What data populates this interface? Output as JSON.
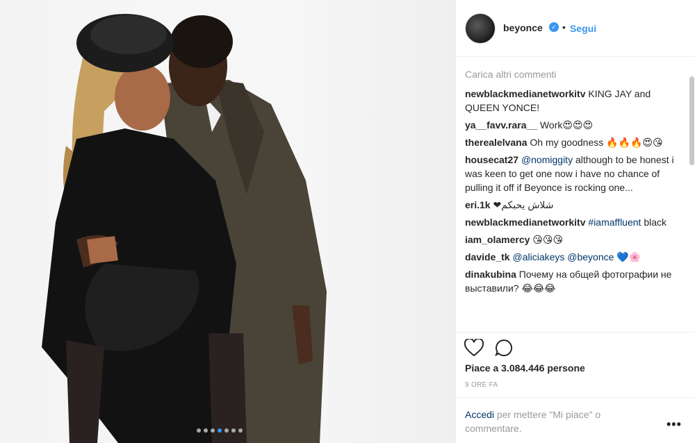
{
  "header": {
    "username": "beyonce",
    "separator": "•",
    "follow_label": "Segui"
  },
  "comments": {
    "load_more": "Carica altri commenti",
    "items": [
      {
        "user": "newblackmedianetworkitv",
        "mention": "",
        "text": "KING JAY and QUEEN YONCE!"
      },
      {
        "user": "ya__favv.rara__",
        "mention": "",
        "text": "Work😍😍😍"
      },
      {
        "user": "therealelvana",
        "mention": "",
        "text": "Oh my goodness 🔥🔥🔥😍😘"
      },
      {
        "user": "housecat27",
        "mention": "@nomiggity",
        "text": "although to be honest i was keen to get one now i have no chance of pulling it off if Beyonce is rocking one..."
      },
      {
        "user": "eri.1k",
        "mention": "",
        "text": "❤شلاش يحبكم"
      },
      {
        "user": "newblackmedianetworkitv",
        "mention": "#iamaffluent",
        "text": "black"
      },
      {
        "user": "iam_olamercy",
        "mention": "",
        "text": "😘😘😘"
      },
      {
        "user": "davide_tk",
        "mention": "@aliciakeys @beyonce",
        "text": "💙🌸"
      },
      {
        "user": "dinakubina",
        "mention": "",
        "text": "Почему на общей фотографии не выставили? 😂😂😂"
      }
    ]
  },
  "actions": {
    "likes": "Piace a 3.084.446 persone",
    "time": "9 ORE FA"
  },
  "footer": {
    "login_link": "Accedi",
    "login_text": " per mettere \"Mi piace\" o commentare.",
    "more": "•••"
  },
  "carousel": {
    "count": 7,
    "active_index": 3
  },
  "colors": {
    "accent": "#3897f0",
    "link": "#003569",
    "muted": "#999999"
  }
}
